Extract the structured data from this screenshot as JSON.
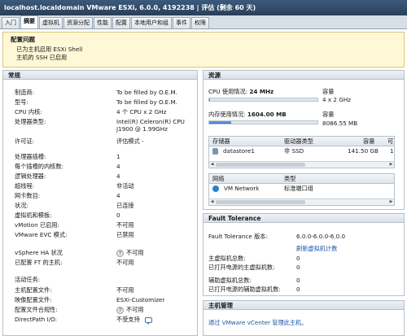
{
  "window": {
    "title": "localhost.localdomain VMware ESXi, 6.0.0, 4192238 | 评估 (剩余 60 天)"
  },
  "tabs": [
    {
      "label": "入门"
    },
    {
      "label": "摘要"
    },
    {
      "label": "虚拟机"
    },
    {
      "label": "资源分配"
    },
    {
      "label": "性能"
    },
    {
      "label": "配置"
    },
    {
      "label": "本地用户和组"
    },
    {
      "label": "事件"
    },
    {
      "label": "权限"
    }
  ],
  "alert": {
    "title": "配置问题",
    "items": [
      "已为主机启用 ESXi Shell",
      "主机的 SSH 已启用"
    ]
  },
  "general": {
    "title": "常规",
    "rows": [
      {
        "label": "制造商:",
        "value": "To be filled by O.E.M."
      },
      {
        "label": "型号:",
        "value": "To be filled by O.E.M."
      },
      {
        "label": "CPU 内核:",
        "value": "4 个 CPU x 2 GHz"
      },
      {
        "label": "处理器类型:",
        "value": "Intel(R) Celeron(R) CPU J1900 @ 1.99GHz"
      },
      {
        "label": "许可证:",
        "value": "评估模式 -"
      },
      {
        "label": "处理器插槽:",
        "value": "1"
      },
      {
        "label": "每个插槽的内核数:",
        "value": "4"
      },
      {
        "label": "逻辑处理器:",
        "value": "4"
      },
      {
        "label": "超线程:",
        "value": "非活动"
      },
      {
        "label": "网卡数目:",
        "value": "4"
      },
      {
        "label": "状况:",
        "value": "已连接"
      },
      {
        "label": "虚拟机和模板:",
        "value": "0"
      },
      {
        "label": "vMotion 已启用:",
        "value": "不可用"
      },
      {
        "label": "VMware EVC 模式:",
        "value": "已禁用"
      },
      {
        "label": "vSphere HA 状况",
        "value": "不可用"
      },
      {
        "label": "已配置 FT 的主机:",
        "value": "不可用"
      },
      {
        "label": "活动任务:",
        "value": ""
      },
      {
        "label": "主机配置文件:",
        "value": "不可用"
      },
      {
        "label": "映像配置文件:",
        "value": "ESXi-Customizer"
      },
      {
        "label": "配置文件合规性:",
        "value": "不可用"
      },
      {
        "label": "DirectPath I/O:",
        "value": "不受支持"
      }
    ]
  },
  "resources": {
    "title": "资源",
    "cpu": {
      "label": "CPU 使用情况:",
      "value": "24 MHz",
      "cap_label": "容量",
      "cap_value": "4 x 2 GHz",
      "fill": 0.003
    },
    "mem": {
      "label": "内存使用情况:",
      "value": "1604.00 MB",
      "cap_label": "容量",
      "cap_value": "8086.55 MB",
      "fill": 0.2
    },
    "storage": {
      "headers": [
        "存储器",
        "驱动器类型",
        "容量",
        "可"
      ],
      "rows": [
        {
          "name": "datastore1",
          "type": "非 SSD",
          "capacity": "141.50 GB",
          "free": "1"
        }
      ]
    },
    "network": {
      "headers": [
        "网络",
        "类型"
      ],
      "rows": [
        {
          "name": "VM Network",
          "type": "标准端口组"
        }
      ]
    }
  },
  "ft": {
    "title": "Fault Tolerance",
    "version_label": "Fault Tolerance 版本:",
    "version_value": "6.0.0-6.0.0-6.0.0",
    "refresh_link": "刷新虚拟机计数",
    "rows": [
      {
        "label": "主虚拟机总数:",
        "value": "0"
      },
      {
        "label": "已打开电源的主虚拟机数:",
        "value": "0"
      },
      {
        "label": "辅助虚拟机总数:",
        "value": "0"
      },
      {
        "label": "已打开电源的辅助虚拟机数:",
        "value": "0"
      }
    ]
  },
  "host_mgmt": {
    "title": "主机管理",
    "link": "通过 VMware vCenter 管理此主机。"
  }
}
